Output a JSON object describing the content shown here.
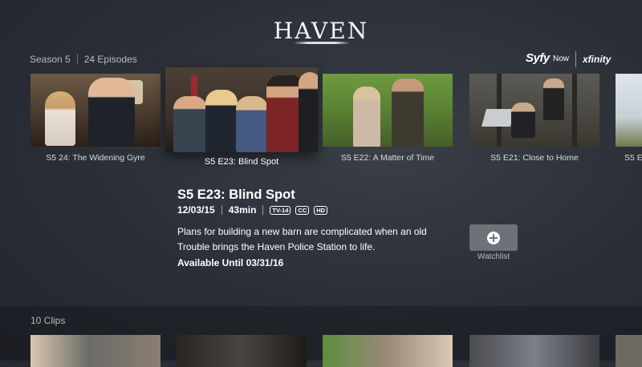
{
  "show": {
    "logo_text": "HAVEN"
  },
  "season": {
    "label": "Season 5",
    "episode_count": "24 Episodes"
  },
  "brands": {
    "syfy": "Syfy",
    "now": "Now",
    "xfinity": "xfinity"
  },
  "episodes": [
    {
      "label": "S5 24: The Widening Gyre"
    },
    {
      "label": "S5 E23: Blind Spot"
    },
    {
      "label": "S5 E22: A Matter of Time"
    },
    {
      "label": "S5 E21: Close to Home"
    },
    {
      "label": "S5 E"
    }
  ],
  "selected": {
    "title": "S5 E23: Blind Spot",
    "date": "12/03/15",
    "duration": "43min",
    "rating_badge": "TV-14",
    "cc_badge": "CC",
    "hd_badge": "HD",
    "description": "Plans for building a new barn are complicated when an old Trouble brings the Haven Police Station to life.",
    "availability": "Available Until 03/31/16"
  },
  "watchlist": {
    "label": "Watchlist",
    "icon": "plus-icon"
  },
  "clips": {
    "title": "10 Clips"
  }
}
